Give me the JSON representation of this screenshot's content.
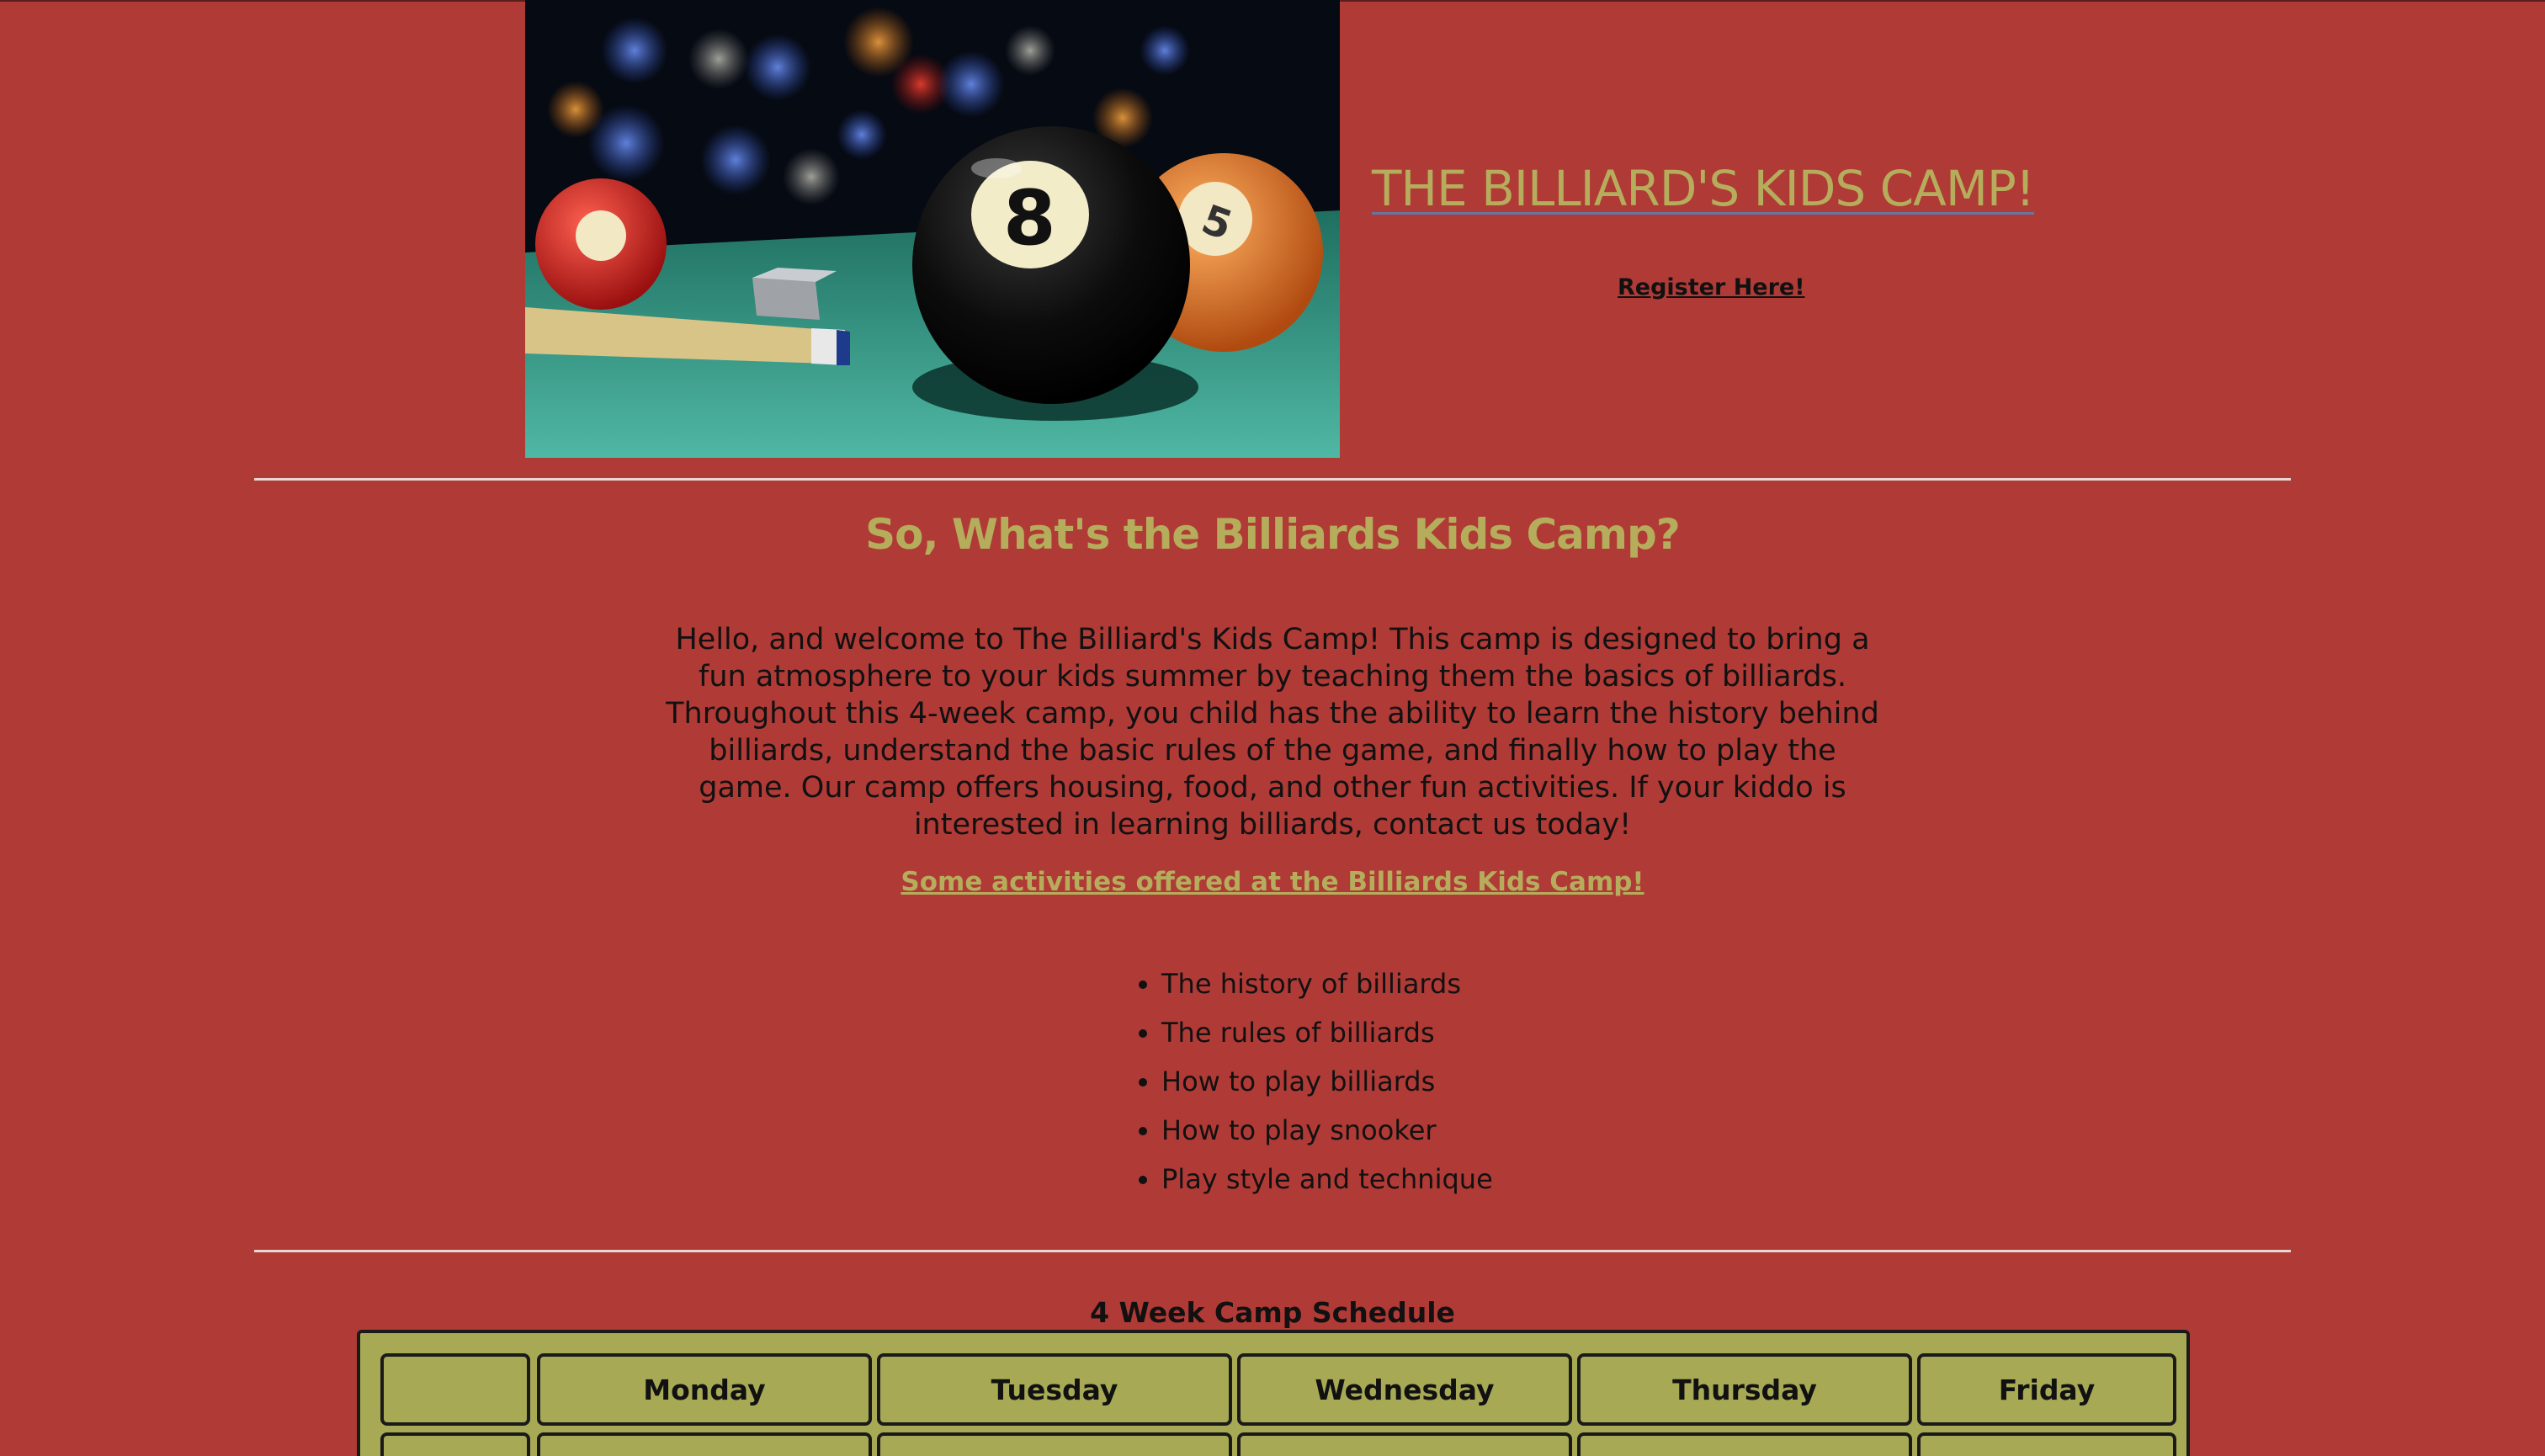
{
  "header": {
    "title": "THE BILLIARD'S KIDS CAMP!",
    "register_label": "Register Here!"
  },
  "about": {
    "heading": "So, What's the Billiards Kids Camp?",
    "intro": "Hello, and welcome to The Billiard's Kids Camp! This camp is designed to bring a fun atmosphere to your kids summer by teaching them the basics of billiards. Throughout this 4-week camp, you child has the ability to learn the history behind billiards, understand the basic rules of the game, and finally how to play the game. Our camp offers housing, food, and other fun activities. If your kiddo is interested in learning billiards, contact us today!"
  },
  "activities": {
    "heading": "Some activities offered at the Billiards Kids Camp!",
    "items": [
      "The history of billiards",
      "The rules of billiards",
      "How to play billiards",
      "How to play snooker",
      "Play style and technique"
    ]
  },
  "schedule": {
    "title": "4 Week Camp Schedule",
    "columns": [
      "",
      "Monday",
      "Tuesday",
      "Wednesday",
      "Thursday",
      "Friday"
    ]
  },
  "colors": {
    "background": "#b03a36",
    "accent": "#b5ad5c",
    "table": "#a8a955"
  }
}
